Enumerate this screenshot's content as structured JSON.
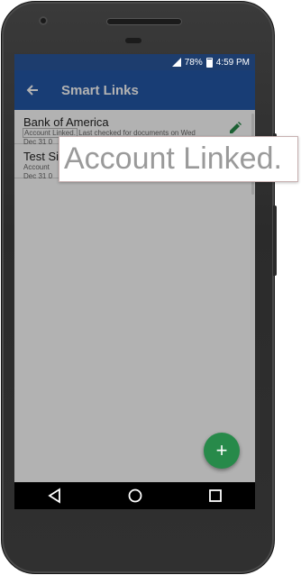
{
  "status_bar": {
    "battery": "78%",
    "time": "4:59 PM"
  },
  "app_bar": {
    "title": "Smart Links"
  },
  "smart_links": [
    {
      "title": "Bank of America",
      "status": "Account Linked.",
      "detail_line1": "Last checked for documents on Wed",
      "detail_line2": "Dec 31 0"
    },
    {
      "title": "Test Si",
      "status": "Account",
      "detail_line1": "",
      "detail_line2": "Dec 31 0"
    }
  ],
  "fab": {
    "label": "+"
  },
  "zoom_tooltip": {
    "text": "Account Linked."
  },
  "colors": {
    "status_bar": "#1d3d6e",
    "app_bar": "#2358a8",
    "fab": "#278a4a",
    "edit_icon": "#278a4a"
  },
  "icons": {
    "back": "arrow-left",
    "edit": "pencil",
    "nav_back": "triangle",
    "nav_home": "circle",
    "nav_recents": "square"
  }
}
